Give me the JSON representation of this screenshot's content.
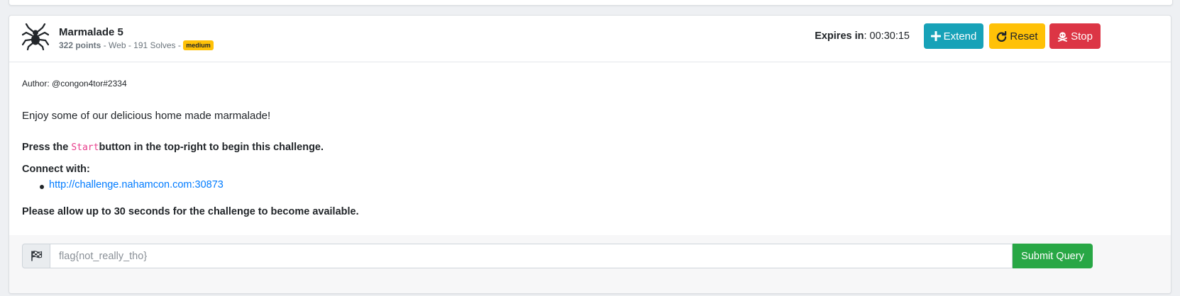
{
  "challenge": {
    "title": "Marmalade 5",
    "points": "322 points",
    "meta_separator1": " - ",
    "category": "Web",
    "meta_separator2": " - ",
    "solves": "191 Solves",
    "meta_separator3": " - ",
    "difficulty": "medium",
    "icon": "spider-icon"
  },
  "timer": {
    "label": "Expires in",
    "value": ": 00:30:15"
  },
  "actions": {
    "extend_label": "Extend",
    "reset_label": "Reset",
    "stop_label": "Stop"
  },
  "body": {
    "author": "Author: @congon4tor#2334",
    "description": "Enjoy some of our delicious home made marmalade!",
    "press_prefix": "Press the ",
    "press_code": "Start",
    "press_suffix": "button in the top-right to begin this challenge.",
    "connect_label": "Connect with:",
    "connect_url": "http://challenge.nahamcon.com:30873",
    "allow_note": "Please allow up to 30 seconds for the challenge to become available."
  },
  "flag_form": {
    "placeholder": "flag{not_really_tho}",
    "value": "",
    "submit_label": "Submit Query",
    "icon": "checkered-flag-icon"
  },
  "colors": {
    "extend": "#17a2b8",
    "reset": "#ffc107",
    "stop": "#dc3545",
    "submit": "#28a745",
    "badge_medium": "#ffc107",
    "link": "#007bff",
    "code": "#e83e8c"
  }
}
